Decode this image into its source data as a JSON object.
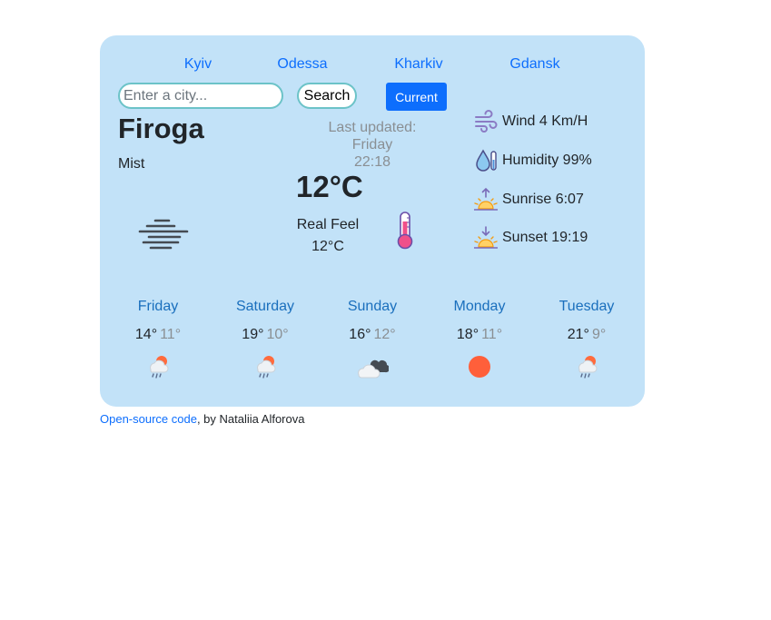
{
  "cities": [
    "Kyiv",
    "Odessa",
    "Kharkiv",
    "Gdansk"
  ],
  "search": {
    "placeholder": "Enter a city...",
    "value": "",
    "button_label": "Search"
  },
  "current_button_label": "Current",
  "weather": {
    "city": "Firoga",
    "description": "Mist",
    "last_updated_label": "Last updated:",
    "last_updated_day": "Friday",
    "last_updated_time": "22:18",
    "temperature": "12°C",
    "real_feel_label": "Real Feel",
    "real_feel_value": "12°C",
    "icon": "mist-icon"
  },
  "details": [
    {
      "label": "Wind 4 Km/H",
      "icon": "wind-icon"
    },
    {
      "label": "Humidity 99%",
      "icon": "humidity-icon"
    },
    {
      "label": "Sunrise 6:07",
      "icon": "sunrise-icon"
    },
    {
      "label": "Sunset 19:19",
      "icon": "sunset-icon"
    }
  ],
  "forecast": [
    {
      "day": "Friday",
      "max": "14°",
      "min": "11°",
      "icon": "rain-sun-icon"
    },
    {
      "day": "Saturday",
      "max": "19°",
      "min": "10°",
      "icon": "rain-sun-icon"
    },
    {
      "day": "Sunday",
      "max": "16°",
      "min": "12°",
      "icon": "cloudy-icon"
    },
    {
      "day": "Monday",
      "max": "18°",
      "min": "11°",
      "icon": "sun-icon"
    },
    {
      "day": "Tuesday",
      "max": "21°",
      "min": "9°",
      "icon": "rain-sun-icon"
    }
  ],
  "footer": {
    "link_text": "Open-source code",
    "rest_text": ", by Nataliia Alforova"
  },
  "colors": {
    "card_background": "#c2e2f8",
    "accent": "#0d6efd",
    "day_name": "#1a6fbd",
    "sun": "#ff5f3a"
  }
}
